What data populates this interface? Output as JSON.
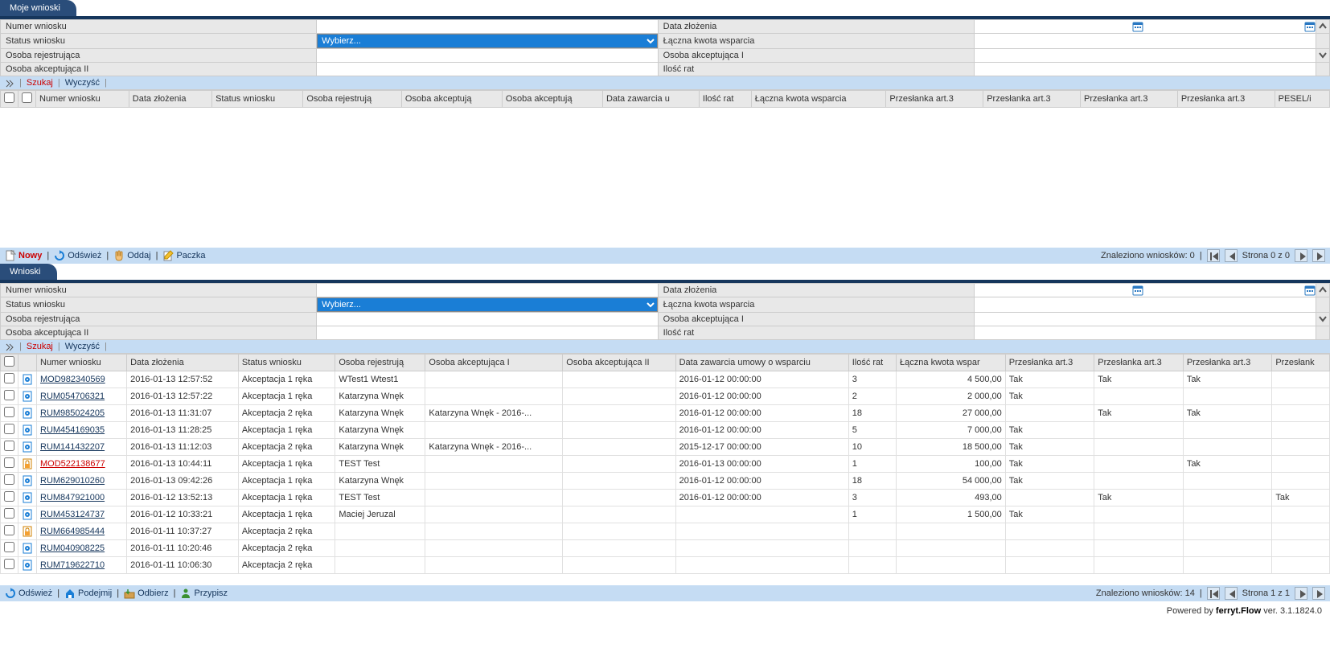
{
  "panel1": {
    "tab": "Moje wnioski",
    "filters": {
      "numer": "Numer wniosku",
      "status": "Status wniosku",
      "osobaRej": "Osoba rejestrująca",
      "osobaAkc2": "Osoba akceptująca II",
      "dataZl": "Data złożenia",
      "kwota": "Łączna kwota wsparcia",
      "osobaAkc1": "Osoba akceptująca I",
      "iloscRat": "Ilość rat",
      "wybierz": "Wybierz..."
    },
    "szukaj": "Szukaj",
    "wyczysc": "Wyczyść",
    "headers": [
      "Numer wniosku",
      "Data złożenia",
      "Status wniosku",
      "Osoba rejestrują",
      "Osoba akceptują",
      "Osoba akceptują",
      "Data zawarcia u",
      "Ilość rat",
      "Łączna kwota wsparcia",
      "Przesłanka art.3",
      "Przesłanka art.3",
      "Przesłanka art.3",
      "Przesłanka art.3",
      "PESEL/i"
    ],
    "actions": {
      "nowy": "Nowy",
      "odswiez": "Odśwież",
      "oddaj": "Oddaj",
      "paczka": "Paczka"
    },
    "pager": {
      "found": "Znaleziono wniosków: 0",
      "page": "Strona 0 z 0"
    }
  },
  "panel2": {
    "tab": "Wnioski",
    "filters": {
      "numer": "Numer wniosku",
      "status": "Status wniosku",
      "osobaRej": "Osoba rejestrująca",
      "osobaAkc2": "Osoba akceptująca II",
      "dataZl": "Data złożenia",
      "kwota": "Łączna kwota wsparcia",
      "osobaAkc1": "Osoba akceptująca I",
      "iloscRat": "Ilość rat",
      "wybierz": "Wybierz..."
    },
    "szukaj": "Szukaj",
    "wyczysc": "Wyczyść",
    "headers": [
      "Numer wniosku",
      "Data złożenia",
      "Status wniosku",
      "Osoba rejestrują",
      "Osoba akceptująca I",
      "Osoba akceptująca II",
      "Data zawarcia umowy o wsparciu",
      "Ilość rat",
      "Łączna kwota wspar",
      "Przesłanka art.3",
      "Przesłanka art.3",
      "Przesłanka art.3",
      "Przesłank"
    ],
    "rows": [
      {
        "ico": "doc",
        "num": "MOD982340569",
        "data": "2016-01-13 12:57:52",
        "status": "Akceptacja 1 ręka",
        "rej": "WTest1 Wtest1",
        "akc1": "",
        "akc2": "",
        "zaw": "2016-01-12 00:00:00",
        "rat": "3",
        "kwota": "4 500,00",
        "p1": "Tak",
        "p2": "Tak",
        "p3": "Tak",
        "p4": ""
      },
      {
        "ico": "doc",
        "num": "RUM054706321",
        "data": "2016-01-13 12:57:22",
        "status": "Akceptacja 1 ręka",
        "rej": "Katarzyna Wnęk",
        "akc1": "",
        "akc2": "",
        "zaw": "2016-01-12 00:00:00",
        "rat": "2",
        "kwota": "2 000,00",
        "p1": "Tak",
        "p2": "",
        "p3": "",
        "p4": ""
      },
      {
        "ico": "doc",
        "num": "RUM985024205",
        "data": "2016-01-13 11:31:07",
        "status": "Akceptacja 2 ręka",
        "rej": "Katarzyna Wnęk",
        "akc1": "Katarzyna Wnęk - 2016-...",
        "akc2": "",
        "zaw": "2016-01-12 00:00:00",
        "rat": "18",
        "kwota": "27 000,00",
        "p1": "",
        "p2": "Tak",
        "p3": "Tak",
        "p4": ""
      },
      {
        "ico": "doc",
        "num": "RUM454169035",
        "data": "2016-01-13 11:28:25",
        "status": "Akceptacja 1 ręka",
        "rej": "Katarzyna Wnęk",
        "akc1": "",
        "akc2": "",
        "zaw": "2016-01-12 00:00:00",
        "rat": "5",
        "kwota": "7 000,00",
        "p1": "Tak",
        "p2": "",
        "p3": "",
        "p4": ""
      },
      {
        "ico": "doc",
        "num": "RUM141432207",
        "data": "2016-01-13 11:12:03",
        "status": "Akceptacja 2 ręka",
        "rej": "Katarzyna Wnęk",
        "akc1": "Katarzyna Wnęk - 2016-...",
        "akc2": "",
        "zaw": "2015-12-17 00:00:00",
        "rat": "10",
        "kwota": "18 500,00",
        "p1": "Tak",
        "p2": "",
        "p3": "",
        "p4": ""
      },
      {
        "ico": "lock",
        "num": "MOD522138677",
        "data": "2016-01-13 10:44:11",
        "status": "Akceptacja 1 ręka",
        "rej": "TEST Test",
        "akc1": "",
        "akc2": "",
        "zaw": "2016-01-13 00:00:00",
        "rat": "1",
        "kwota": "100,00",
        "p1": "Tak",
        "p2": "",
        "p3": "Tak",
        "p4": "",
        "red": true
      },
      {
        "ico": "doc",
        "num": "RUM629010260",
        "data": "2016-01-13 09:42:26",
        "status": "Akceptacja 1 ręka",
        "rej": "Katarzyna Wnęk",
        "akc1": "",
        "akc2": "",
        "zaw": "2016-01-12 00:00:00",
        "rat": "18",
        "kwota": "54 000,00",
        "p1": "Tak",
        "p2": "",
        "p3": "",
        "p4": ""
      },
      {
        "ico": "doc",
        "num": "RUM847921000",
        "data": "2016-01-12 13:52:13",
        "status": "Akceptacja 1 ręka",
        "rej": "TEST Test",
        "akc1": "",
        "akc2": "",
        "zaw": "2016-01-12 00:00:00",
        "rat": "3",
        "kwota": "493,00",
        "p1": "",
        "p2": "Tak",
        "p3": "",
        "p4": "Tak"
      },
      {
        "ico": "doc",
        "num": "RUM453124737",
        "data": "2016-01-12 10:33:21",
        "status": "Akceptacja 1 ręka",
        "rej": "Maciej Jeruzal",
        "akc1": "",
        "akc2": "",
        "zaw": "",
        "rat": "1",
        "kwota": "1 500,00",
        "p1": "Tak",
        "p2": "",
        "p3": "",
        "p4": ""
      },
      {
        "ico": "lock",
        "num": "RUM664985444",
        "data": "2016-01-11 10:37:27",
        "status": "Akceptacja 2 ręka",
        "rej": "",
        "akc1": "",
        "akc2": "",
        "zaw": "",
        "rat": "",
        "kwota": "",
        "p1": "",
        "p2": "",
        "p3": "",
        "p4": ""
      },
      {
        "ico": "doc",
        "num": "RUM040908225",
        "data": "2016-01-11 10:20:46",
        "status": "Akceptacja 2 ręka",
        "rej": "",
        "akc1": "",
        "akc2": "",
        "zaw": "",
        "rat": "",
        "kwota": "",
        "p1": "",
        "p2": "",
        "p3": "",
        "p4": ""
      },
      {
        "ico": "doc",
        "num": "RUM719622710",
        "data": "2016-01-11 10:06:30",
        "status": "Akceptacja 2 ręka",
        "rej": "",
        "akc1": "",
        "akc2": "",
        "zaw": "",
        "rat": "",
        "kwota": "",
        "p1": "",
        "p2": "",
        "p3": "",
        "p4": ""
      }
    ],
    "actions": {
      "odswiez": "Odśwież",
      "podejmij": "Podejmij",
      "odbierz": "Odbierz",
      "przypisz": "Przypisz"
    },
    "pager": {
      "found": "Znaleziono wniosków: 14",
      "page": "Strona 1 z 1"
    }
  },
  "footer": {
    "prefix": "Powered by ",
    "product": "ferryt.Flow",
    "ver": " ver. 3.1.1824.0"
  }
}
